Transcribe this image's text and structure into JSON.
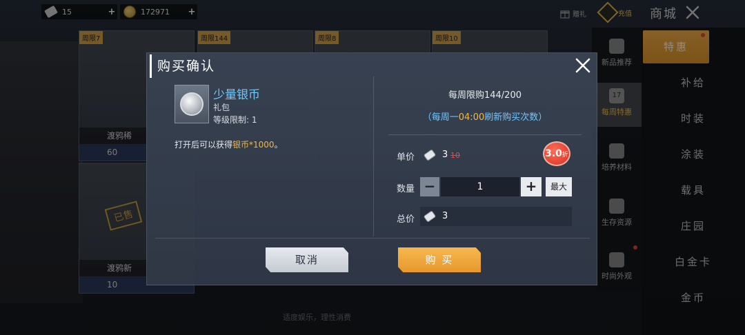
{
  "topbar": {
    "silver_amount": "15",
    "gold_amount": "172971",
    "plus": "+",
    "gift_label": "赠礼",
    "recharge_label": "充值",
    "shop_title": "商城"
  },
  "bg_cards": [
    {
      "tag": "周限7",
      "foot": "渡鸦稀",
      "price": "60"
    },
    {
      "tag": "周限144",
      "foot": "",
      "price": ""
    },
    {
      "tag": "周限8",
      "foot": "",
      "price": ""
    },
    {
      "tag": "周限10",
      "foot": "",
      "price": ""
    },
    {
      "tag": "",
      "foot": "渡鸦新",
      "price": "10"
    }
  ],
  "bg_stamp": "已售",
  "left_nav": [
    {
      "label": "新品推荐"
    },
    {
      "label": "每周特惠"
    },
    {
      "label": "培养材料"
    },
    {
      "label": "生存资源"
    },
    {
      "label": "时尚外观"
    }
  ],
  "left_nav_calendar_day": "17",
  "right_nav": [
    {
      "label": "特惠"
    },
    {
      "label": "补给"
    },
    {
      "label": "时装"
    },
    {
      "label": "涂装"
    },
    {
      "label": "载具"
    },
    {
      "label": "庄园"
    },
    {
      "label": "白金卡"
    },
    {
      "label": "金币"
    }
  ],
  "footer_note": "适度娱乐，理性消费",
  "modal": {
    "title": "购买确认",
    "item": {
      "name": "少量银币",
      "type": "礼包",
      "level_limit": "等级限制: 1",
      "desc_prefix": "打开后可以获得",
      "desc_highlight": "银币*1000",
      "desc_suffix": "。"
    },
    "weekly_limit": "每周限购144/200",
    "refresh_prefix": "（每周一",
    "refresh_time": "04:00",
    "refresh_suffix": "刷新购买次数）",
    "unit_price_label": "单价",
    "unit_price_now": "3",
    "unit_price_old": "10",
    "discount_value": "3.0",
    "discount_unit": "折",
    "quantity_label": "数量",
    "quantity_value": "1",
    "minus": "−",
    "plus": "+",
    "max_label": "最大",
    "total_label": "总价",
    "total_value": "3",
    "cancel_label": "取消",
    "buy_label": "购 买"
  },
  "colors": {
    "accent_orange": "#f5b742",
    "item_blue": "#6ec8ff",
    "strike_red": "#e24b4b"
  }
}
